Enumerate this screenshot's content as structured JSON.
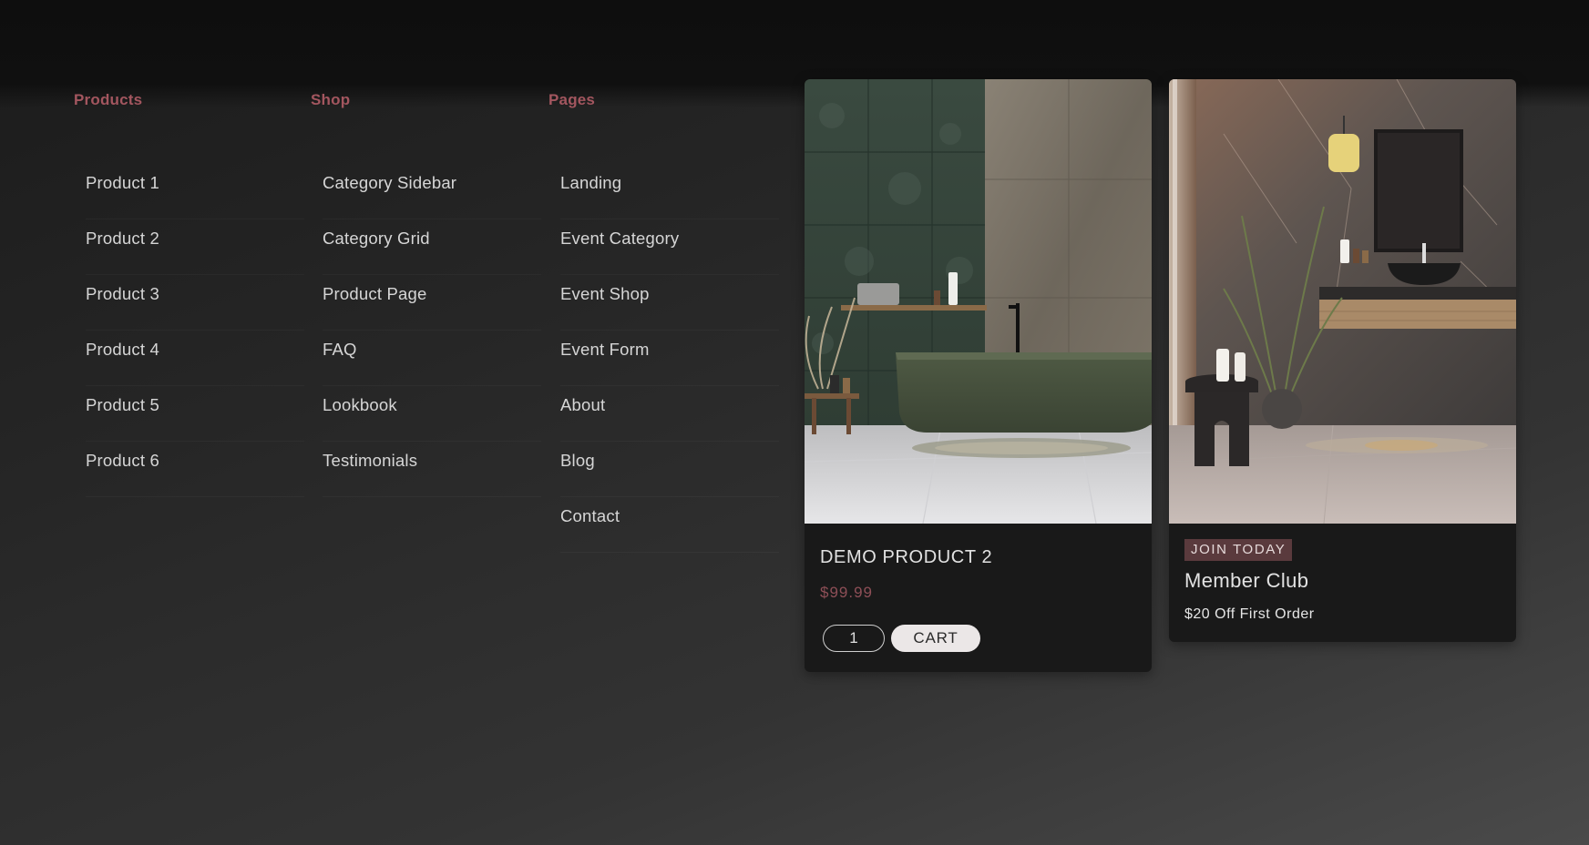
{
  "menu": {
    "products": {
      "heading": "Products",
      "items": [
        "Product 1",
        "Product 2",
        "Product 3",
        "Product 4",
        "Product 5",
        "Product 6"
      ]
    },
    "shop": {
      "heading": "Shop",
      "items": [
        "Category Sidebar",
        "Category Grid",
        "Product Page",
        "FAQ",
        "Lookbook",
        "Testimonials"
      ]
    },
    "pages": {
      "heading": "Pages",
      "items": [
        "Landing",
        "Event Category",
        "Event Shop",
        "Event Form",
        "About",
        "Blog",
        "Contact"
      ]
    }
  },
  "product_card": {
    "name": "DEMO PRODUCT 2",
    "price": "$99.99",
    "quantity": "1",
    "cart_label": "CART",
    "image_icon": "bathroom-bathtub-photo"
  },
  "member_card": {
    "badge": "JOIN TODAY",
    "title": "Member Club",
    "offer": "$20 Off First Order",
    "image_icon": "bathroom-vanity-photo"
  },
  "colors": {
    "accent": "#a3565f",
    "price": "#8e4f57",
    "badge_bg": "#5a3a3d",
    "card_bg": "#191919",
    "cart_button_bg": "#ebe7e7"
  }
}
